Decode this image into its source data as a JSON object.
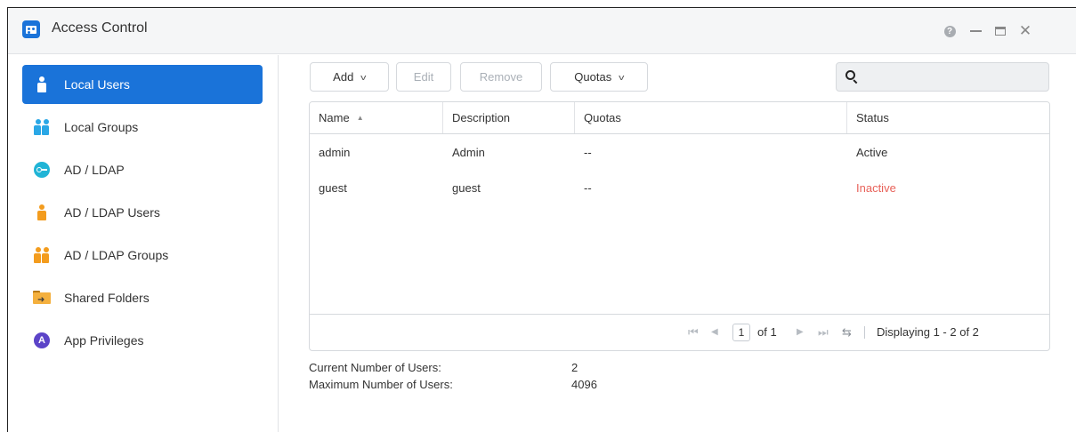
{
  "window": {
    "title": "Access Control",
    "help_glyph": "?",
    "close_glyph": "✕"
  },
  "sidebar": {
    "items": [
      {
        "label": "Local Users",
        "icon": "person-icon",
        "active": true
      },
      {
        "label": "Local Groups",
        "icon": "group-icon",
        "active": false
      },
      {
        "label": "AD / LDAP",
        "icon": "key-icon",
        "active": false
      },
      {
        "label": "AD / LDAP Users",
        "icon": "person-icon",
        "active": false
      },
      {
        "label": "AD / LDAP Groups",
        "icon": "group-icon",
        "active": false
      },
      {
        "label": "Shared Folders",
        "icon": "folder-icon",
        "active": false
      },
      {
        "label": "App Privileges",
        "icon": "privilege-icon",
        "active": false
      }
    ]
  },
  "toolbar": {
    "add_label": "Add",
    "edit_label": "Edit",
    "remove_label": "Remove",
    "quotas_label": "Quotas",
    "chevron_glyph": "v"
  },
  "search": {
    "value": "",
    "placeholder": ""
  },
  "grid": {
    "columns": [
      "Name",
      "Description",
      "Quotas",
      "Status"
    ],
    "sort_glyph": "▲",
    "rows": [
      {
        "name": "admin",
        "description": "Admin",
        "quotas": "--",
        "status": "Active"
      },
      {
        "name": "guest",
        "description": "guest",
        "quotas": "--",
        "status": "Inactive"
      }
    ]
  },
  "pager": {
    "first_glyph": "⏮",
    "prev_glyph": "◀",
    "current_page": "1",
    "of_text": "of 1",
    "next_glyph": "▶",
    "last_glyph": "⏭",
    "refresh_glyph": "⇆",
    "display_text": "Displaying 1 - 2 of 2"
  },
  "stats": {
    "current_label": "Current Number of Users:",
    "current_value": "2",
    "max_label": "Maximum Number of Users:",
    "max_value": "4096"
  },
  "colors": {
    "accent": "#1a73d9",
    "inactive": "#e8625a",
    "person_local": "#2aa7e6",
    "person_ad": "#f39c1e"
  }
}
